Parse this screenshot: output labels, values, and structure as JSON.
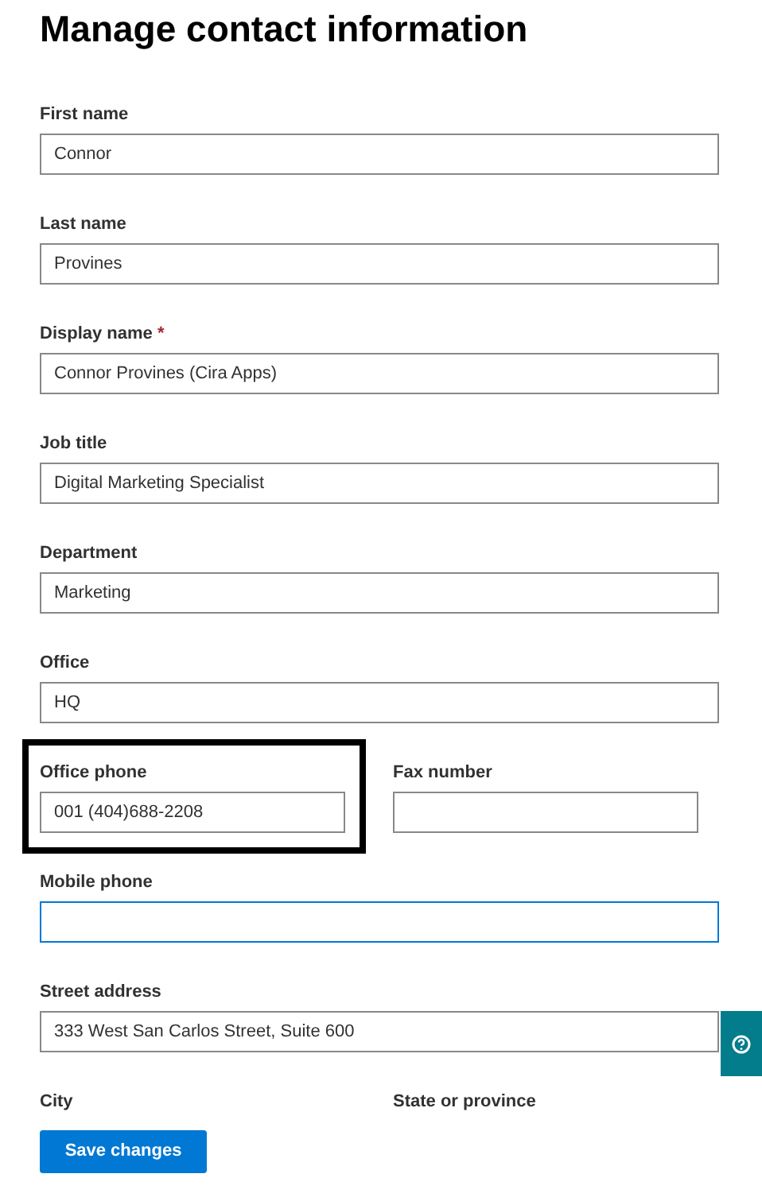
{
  "title": "Manage contact information",
  "rows": [
    {
      "fields": [
        {
          "kind": "input",
          "label": "First name",
          "value": "Connor",
          "focused": false
        }
      ]
    },
    {
      "fields": [
        {
          "kind": "input",
          "label": "Last name",
          "value": "Provines",
          "focused": false
        }
      ]
    },
    {
      "fields": [
        {
          "kind": "input",
          "label": "Display name",
          "required_mark": "*",
          "value": "Connor Provines (Cira Apps)",
          "focused": false
        }
      ]
    },
    {
      "fields": [
        {
          "kind": "input",
          "label": "Job title",
          "value": "Digital Marketing Specialist",
          "focused": false
        }
      ]
    },
    {
      "fields": [
        {
          "kind": "input",
          "label": "Department",
          "value": "Marketing",
          "focused": false
        }
      ]
    },
    {
      "fields": [
        {
          "kind": "input",
          "label": "Office",
          "value": "HQ",
          "focused": false
        }
      ]
    },
    {
      "fields": [
        {
          "kind": "input",
          "label": "Office phone",
          "value": "001 (404)688-2208",
          "focused": false,
          "highlighted": true
        },
        {
          "kind": "input",
          "label": "Fax number",
          "focused": false
        }
      ]
    },
    {
      "fields": [
        {
          "kind": "input",
          "label": "Mobile phone",
          "focused": true
        }
      ]
    },
    {
      "fields": [
        {
          "kind": "input",
          "label": "Street address",
          "value": "333 West San Carlos Street, Suite 600",
          "focused": false
        }
      ]
    },
    {
      "fields": [
        {
          "kind": "label",
          "label": "City"
        },
        {
          "kind": "label",
          "label": "State or province"
        }
      ]
    }
  ],
  "save_button": "Save changes"
}
